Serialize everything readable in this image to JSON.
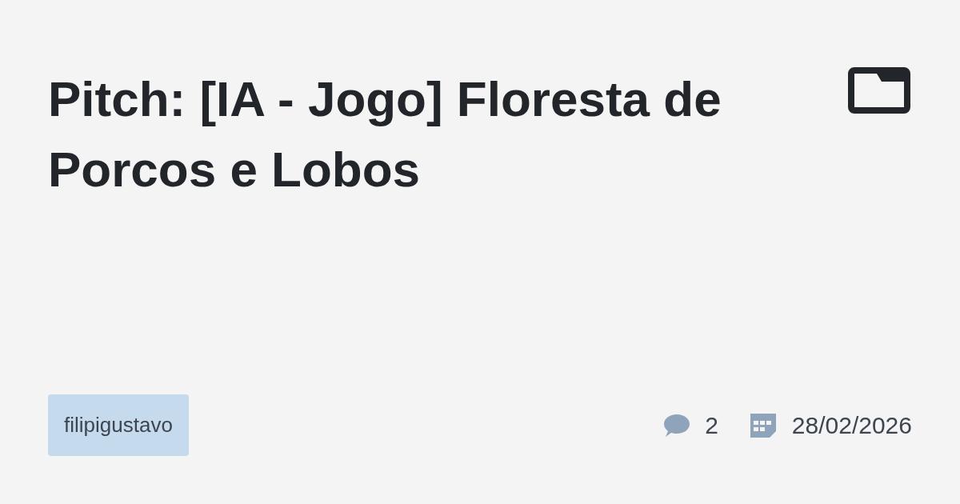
{
  "title": "Pitch: [IA - Jogo] Floresta de Porcos e Lobos",
  "author": "filipigustavo",
  "comments": "2",
  "date": "28/02/2026"
}
